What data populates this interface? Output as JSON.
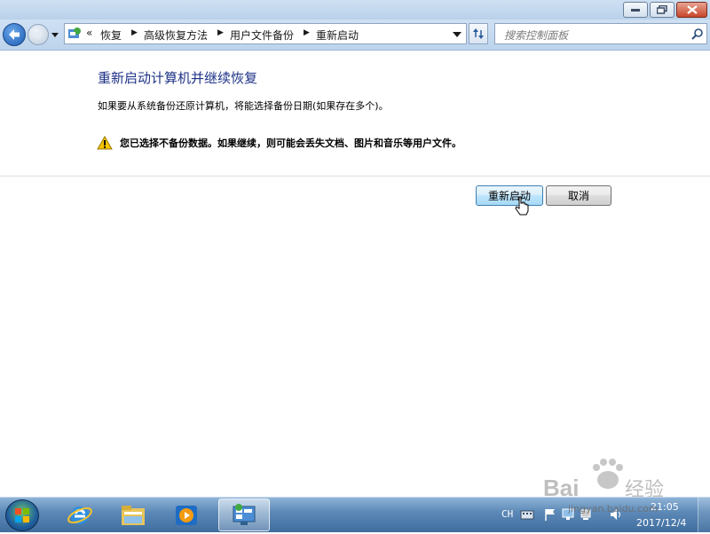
{
  "window": {
    "breadcrumbs": {
      "overflow": "«",
      "items": [
        "恢复",
        "高级恢复方法",
        "用户文件备份",
        "重新启动"
      ]
    },
    "search_placeholder": "搜索控制面板"
  },
  "content": {
    "title": "重新启动计算机并继续恢复",
    "description": "如果要从系统备份还原计算机，将能选择备份日期(如果存在多个)。",
    "warning": "您已选择不备份数据。如果继续，则可能会丢失文档、图片和音乐等用户文件。",
    "restart_label": "重新启动",
    "cancel_label": "取消"
  },
  "taskbar": {
    "language": "CH",
    "time": "21:05",
    "date": "2017/12/4"
  },
  "watermark": {
    "url": "jingyan.baidu.com"
  },
  "colors": {
    "title_blue": "#1e3287",
    "warning_yellow": "#f5c400"
  }
}
